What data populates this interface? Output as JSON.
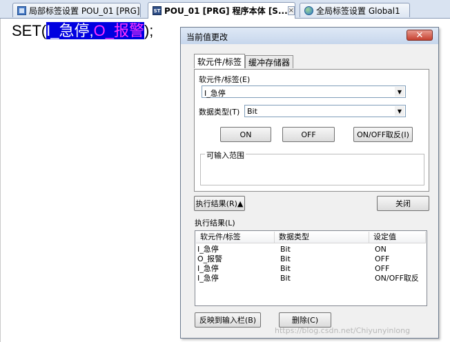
{
  "tabs": [
    {
      "label": "局部标签设置 POU_01 [PRG]",
      "icon": "local-label-icon"
    },
    {
      "label": "POU_01 [PRG] 程序本体 [S...",
      "icon": "st-program-icon"
    },
    {
      "label": "全局标签设置 Global1",
      "icon": "global-label-icon"
    }
  ],
  "tab_close": "×",
  "editor": {
    "prefix": "SET(",
    "arg1": "I_急停",
    "comma": ",",
    "arg2": "O_报警",
    "suffix": ");"
  },
  "dialog": {
    "title": "当前值更改",
    "close": "✕",
    "tabs": [
      "软元件/标签",
      "缓冲存储器"
    ],
    "device_label": "软元件/标签(E)",
    "device_value": "I_急停",
    "type_label": "数据类型(T)",
    "type_value": "Bit",
    "buttons": {
      "on": "ON",
      "off": "OFF",
      "toggle": "ON/OFF取反(I)"
    },
    "range_label": "可输入范围",
    "exec_button": "执行结果(R)▲",
    "close_button": "关闭",
    "results_label": "执行结果(L)",
    "results": {
      "columns": [
        "软元件/标签",
        "数据类型",
        "设定值"
      ],
      "rows": [
        [
          "I_急停",
          "Bit",
          "ON"
        ],
        [
          "O_报警",
          "Bit",
          "OFF"
        ],
        [
          "I_急停",
          "Bit",
          "OFF"
        ],
        [
          "I_急停",
          "Bit",
          "ON/OFF取反"
        ]
      ]
    },
    "reflect_button": "反映到输入栏(B)",
    "delete_button": "删除(C)"
  },
  "watermark": "https://blog.csdn.net/Chiyunyinlong",
  "colors": {
    "selection": "#0000e0",
    "arg2_text": "#ff33ff",
    "tab_strip": "#d9e3f1"
  }
}
